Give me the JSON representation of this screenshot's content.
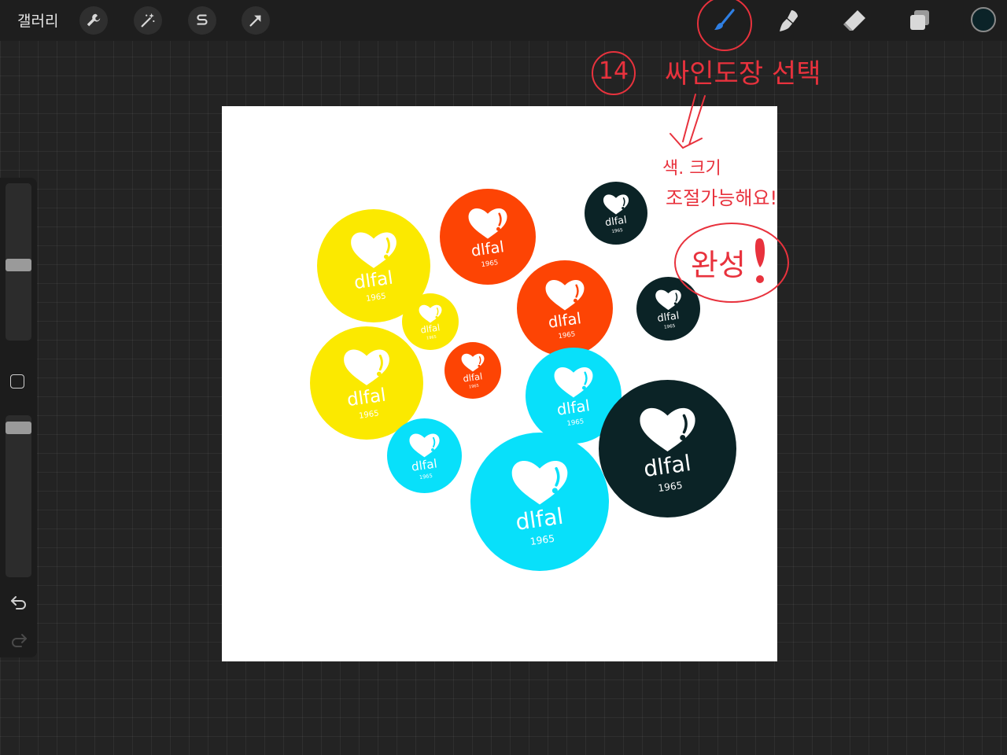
{
  "toolbar": {
    "gallery_label": "갤러리",
    "left_tools": [
      {
        "name": "actions-wrench-icon"
      },
      {
        "name": "adjustments-wand-icon"
      },
      {
        "name": "selection-s-icon"
      },
      {
        "name": "transform-arrow-icon"
      }
    ],
    "right_tools": [
      {
        "name": "brush-icon",
        "active": true
      },
      {
        "name": "smudge-icon"
      },
      {
        "name": "eraser-icon"
      },
      {
        "name": "layers-icon"
      }
    ],
    "current_color": "#0b2328",
    "accent_color": "#2f7fe3"
  },
  "sidebar": {
    "brush_size_level": 0.63,
    "opacity_level": 0.93,
    "icons": [
      "modify-square-icon",
      "undo-icon",
      "redo-icon"
    ]
  },
  "sticker": {
    "brand": "dlfal",
    "year": "1965"
  },
  "palette": {
    "yellow": "#fbe900",
    "orange": "#fd4404",
    "cyan": "#08e0fa",
    "dark": "#0b2326"
  },
  "annotations": {
    "step_number": "14",
    "step_text": "싸인도장 선택",
    "note_line1": "색. 크기",
    "note_line2": "조절가능해요!",
    "complete": "완성"
  }
}
